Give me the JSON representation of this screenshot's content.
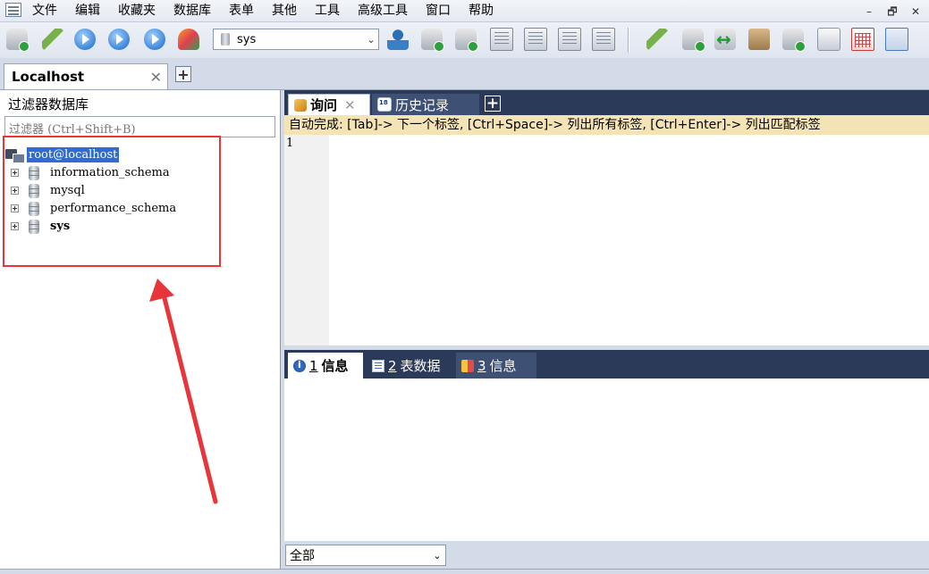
{
  "menu": {
    "items": [
      "文件",
      "编辑",
      "收藏夹",
      "数据库",
      "表单",
      "其他",
      "工具",
      "高级工具",
      "窗口",
      "帮助"
    ]
  },
  "window_controls": {
    "minimize": "–",
    "restore": "🗗",
    "close": "✕"
  },
  "toolbar": {
    "db_selector_value": "sys"
  },
  "connection_tab": {
    "label": "Localhost",
    "close": "✕",
    "add": "+"
  },
  "object_browser": {
    "title": "过滤器数据库",
    "filter_placeholder": "过滤器 (Ctrl+Shift+B)",
    "root": "root@localhost",
    "databases": [
      {
        "name": "information_schema",
        "bold": false
      },
      {
        "name": "mysql",
        "bold": false
      },
      {
        "name": "performance_schema",
        "bold": false
      },
      {
        "name": "sys",
        "bold": true
      }
    ]
  },
  "editor_tabs": {
    "query": {
      "label": "询问",
      "close": "✕"
    },
    "history": {
      "label": "历史记录"
    },
    "add": "+"
  },
  "editor": {
    "autocomplete_hint": "自动完成: [Tab]-> 下一个标签, [Ctrl+Space]-> 列出所有标签, [Ctrl+Enter]-> 列出匹配标签",
    "line_number": "1"
  },
  "results_tabs": [
    {
      "num": "1",
      "label": "信息"
    },
    {
      "num": "2",
      "label": "表数据"
    },
    {
      "num": "3",
      "label": "信息"
    }
  ],
  "results_filter": {
    "value": "全部"
  },
  "colors": {
    "annotation_red": "#e8353a",
    "tab_bar_dark": "#2b3a58",
    "selection_blue": "#2f6bd0",
    "hint_bg": "#f4e4b5"
  }
}
